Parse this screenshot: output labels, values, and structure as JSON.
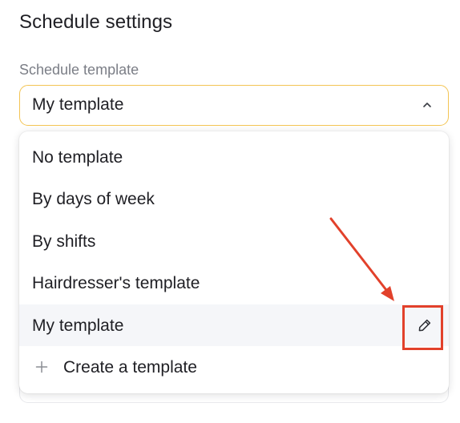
{
  "page": {
    "title": "Schedule settings"
  },
  "schedule_template": {
    "label": "Schedule template",
    "selected_value": "My template",
    "options": [
      {
        "label": "No template"
      },
      {
        "label": "By days of week"
      },
      {
        "label": "By shifts"
      },
      {
        "label": "Hairdresser's template"
      },
      {
        "label": "My template",
        "highlighted": true,
        "action_icon": "pencil-edit-icon"
      }
    ],
    "create_action": {
      "label": "Create a template",
      "icon": "plus-icon"
    }
  },
  "colors": {
    "focus_border": "#f3c453",
    "highlight_background": "#f5f6f9",
    "annotation": "#e2412b"
  }
}
